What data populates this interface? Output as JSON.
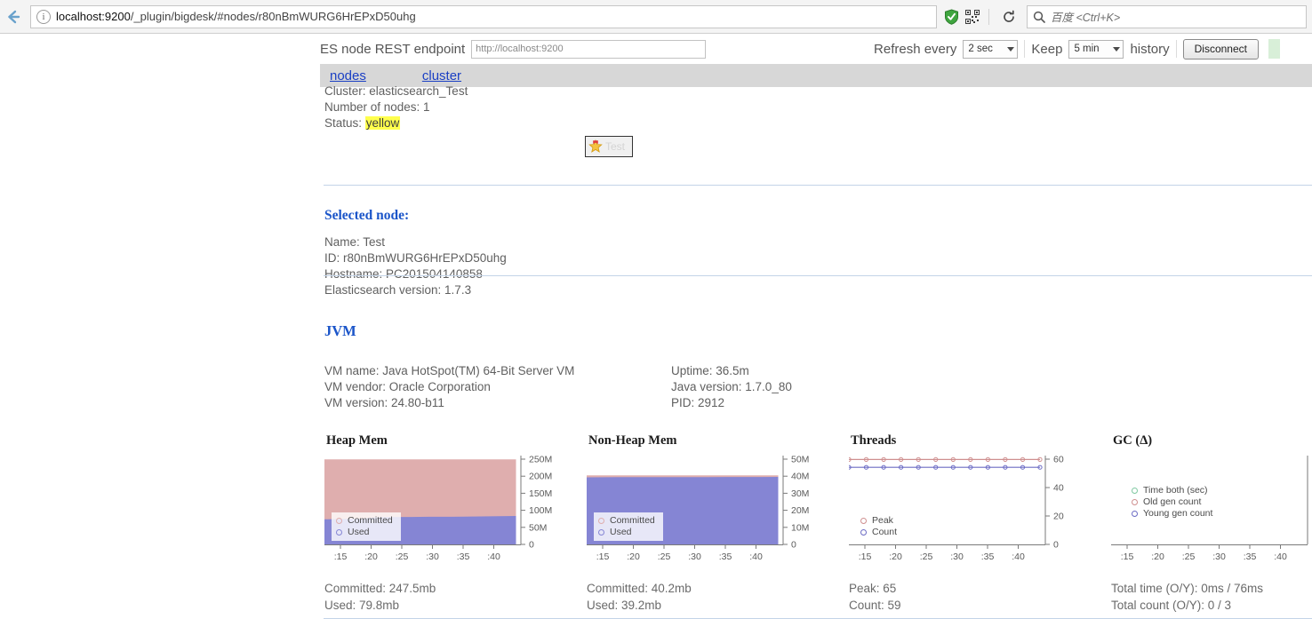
{
  "browser": {
    "url_host": "localhost:9200",
    "url_rest": "/_plugin/bigdesk/#nodes/r80nBmWURG6HrEPxD50uhg",
    "info_icon": "info-icon",
    "back_icon": "back-arrow-icon",
    "shield_icon": "shield-icon",
    "qr_icon": "qr-code-icon",
    "reload_icon": "reload-icon",
    "search_icon": "search-icon",
    "search_placeholder": "百度 <Ctrl+K>"
  },
  "toolbar": {
    "endpoint_label": "ES node REST endpoint",
    "endpoint_value": "http://localhost:9200",
    "refresh_label": "Refresh every",
    "refresh_value": "2 sec",
    "keep_label": "Keep",
    "keep_value": "5 min",
    "history_label": "history",
    "disconnect_label": "Disconnect"
  },
  "nav": {
    "nodes": "nodes",
    "cluster": "cluster"
  },
  "cluster": {
    "name_line": "Cluster: elasticsearch_Test",
    "nodes_line": "Number of nodes: 1",
    "status_label": "Status:",
    "status_value": "yellow",
    "node_chip_label": "Test"
  },
  "selected_node": {
    "heading": "Selected node:",
    "name": "Name: Test",
    "id": "ID: r80nBmWURG6HrEPxD50uhg",
    "hostname": "Hostname: PC201504140858",
    "version": "Elasticsearch version: 1.7.3"
  },
  "jvm": {
    "heading": "JVM",
    "vm_name": "VM name: Java HotSpot(TM) 64-Bit Server VM",
    "vm_vendor": "VM vendor: Oracle Corporation",
    "vm_version": "VM version: 24.80-b11",
    "uptime": "Uptime: 36.5m",
    "java_version": "Java version: 1.7.0_80",
    "pid": "PID: 2912"
  },
  "colors": {
    "committed_pink": "#dfaeae",
    "used_purple": "#8585d4",
    "peak_line": "#cf8f8f",
    "count_line": "#6b6bc4",
    "time_green": "#7fc8a0",
    "link_blue": "#1a3fc4",
    "heading_blue": "#1b55c9",
    "status_highlight": "#ffff4d"
  },
  "chart_data": [
    {
      "type": "area",
      "title": "Heap Mem",
      "xlabel": "",
      "ylabel": "",
      "x_ticks": [
        ":15",
        ":20",
        ":25",
        ":30",
        ":35",
        ":40"
      ],
      "y_ticks": [
        "0",
        "50M",
        "100M",
        "150M",
        "200M",
        "250M"
      ],
      "ylim": [
        0,
        260000000
      ],
      "grid": false,
      "legend_position": "bottom-left",
      "series": [
        {
          "name": "Committed",
          "color": "#dfaeae",
          "values": [
            247500000,
            247500000,
            247500000,
            247500000,
            247500000,
            247500000,
            247500000,
            247500000,
            247500000,
            247500000,
            247500000,
            247500000
          ]
        },
        {
          "name": "Used",
          "color": "#8585d4",
          "values": [
            72000000,
            73000000,
            74000000,
            78000000,
            79000000,
            79000000,
            79500000,
            79500000,
            79800000,
            80500000,
            81500000,
            82000000
          ]
        }
      ],
      "stats": [
        "Committed: 247.5mb",
        "Used: 79.8mb"
      ]
    },
    {
      "type": "area",
      "title": "Non-Heap Mem",
      "xlabel": "",
      "ylabel": "",
      "x_ticks": [
        ":15",
        ":20",
        ":25",
        ":30",
        ":35",
        ":40"
      ],
      "y_ticks": [
        "0",
        "10M",
        "20M",
        "30M",
        "40M",
        "50M"
      ],
      "ylim": [
        0,
        52000000
      ],
      "grid": false,
      "legend_position": "bottom-left",
      "series": [
        {
          "name": "Committed",
          "color": "#dfaeae",
          "values": [
            40200000,
            40200000,
            40200000,
            40200000,
            40200000,
            40200000,
            40200000,
            40200000,
            40200000,
            40200000,
            40200000,
            40200000
          ]
        },
        {
          "name": "Used",
          "color": "#8585d4",
          "values": [
            39000000,
            39050000,
            39100000,
            39120000,
            39150000,
            39150000,
            39180000,
            39180000,
            39200000,
            39200000,
            39220000,
            39250000
          ]
        }
      ],
      "stats": [
        "Committed: 40.2mb",
        "Used: 39.2mb"
      ]
    },
    {
      "type": "line",
      "title": "Threads",
      "xlabel": "",
      "ylabel": "",
      "x_ticks": [
        ":15",
        ":20",
        ":25",
        ":30",
        ":35",
        ":40"
      ],
      "y_ticks": [
        "0",
        "20",
        "40",
        "60"
      ],
      "ylim": [
        0,
        68
      ],
      "grid": false,
      "legend_position": "bottom-left",
      "series": [
        {
          "name": "Peak",
          "color": "#cf8f8f",
          "values": [
            65,
            65,
            65,
            65,
            65,
            65,
            65,
            65,
            65,
            65,
            65,
            65
          ]
        },
        {
          "name": "Count",
          "color": "#6b6bc4",
          "values": [
            59,
            59,
            59,
            59,
            59,
            59,
            59,
            59,
            59,
            59,
            59,
            59
          ]
        }
      ],
      "stats": [
        "Peak: 65",
        "Count: 59"
      ]
    },
    {
      "type": "line",
      "title": "GC (Δ)",
      "xlabel": "",
      "ylabel": "",
      "x_ticks": [
        ":15",
        ":20",
        ":25",
        ":30",
        ":35",
        ":40"
      ],
      "y_ticks": [],
      "ylim": [
        0,
        1
      ],
      "grid": false,
      "legend_position": "middle-left",
      "series": [
        {
          "name": "Time both (sec)",
          "color": "#7fc8a0",
          "values": [
            0,
            0,
            0,
            0,
            0,
            0,
            0,
            0,
            0,
            0,
            0,
            0
          ]
        },
        {
          "name": "Old gen count",
          "color": "#cf8f8f",
          "values": [
            0,
            0,
            0,
            0,
            0,
            0,
            0,
            0,
            0,
            0,
            0,
            0
          ]
        },
        {
          "name": "Young gen count",
          "color": "#6b6bc4",
          "values": [
            0,
            0,
            0,
            0,
            0,
            0,
            0,
            0,
            0,
            0,
            0,
            0
          ]
        }
      ],
      "stats": [
        "Total time (O/Y): 0ms / 76ms",
        "Total count (O/Y): 0 / 3"
      ]
    }
  ]
}
